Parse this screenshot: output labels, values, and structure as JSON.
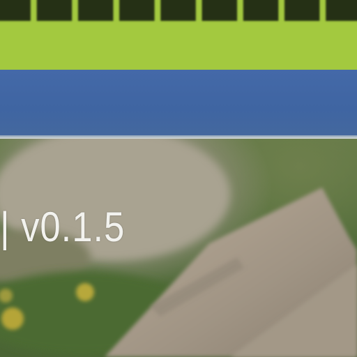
{
  "banner": {
    "color": "#a3c93f"
  },
  "header_bar": {
    "color": "#4268a5"
  },
  "footer": {
    "version_label": "| v0.1.5"
  }
}
